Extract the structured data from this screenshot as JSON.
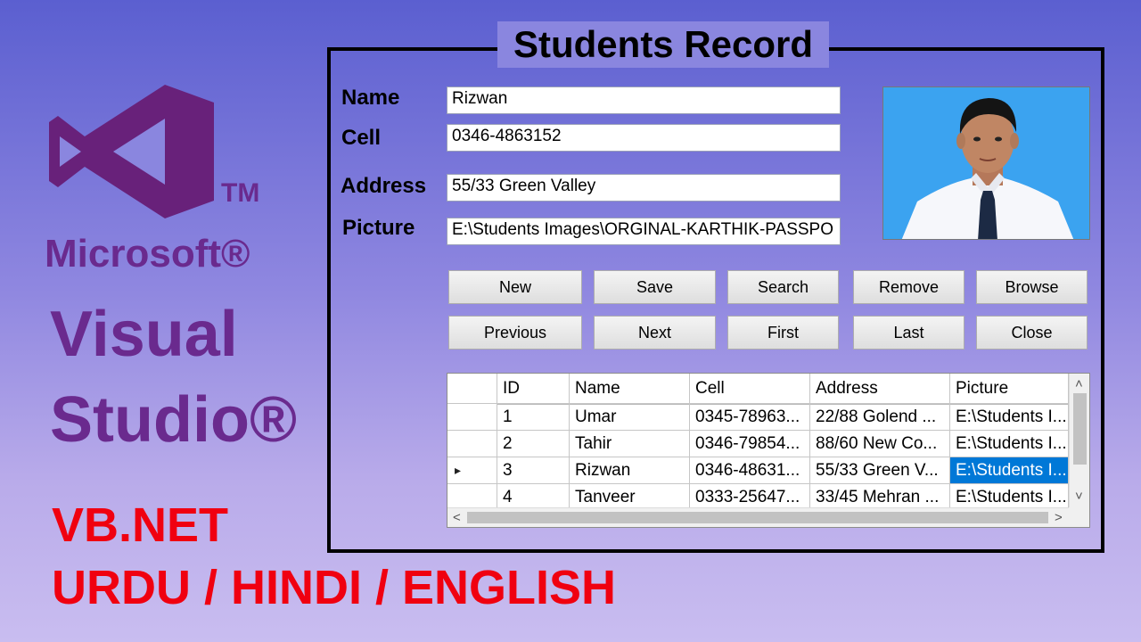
{
  "branding": {
    "tm": "TM",
    "microsoft": "Microsoft®",
    "visual": "Visual",
    "studio": "Studio®",
    "vbnet": "VB.NET",
    "languages": "URDU / HINDI / ENGLISH",
    "logo_color": "#68217a",
    "text_color": "#6a2a8e",
    "accent_red": "#f00010"
  },
  "form": {
    "title": "Students Record",
    "fields": {
      "name": {
        "label": "Name",
        "value": "Rizwan"
      },
      "cell": {
        "label": "Cell",
        "value": "0346-4863152"
      },
      "address": {
        "label": "Address",
        "value": "55/33 Green Valley"
      },
      "picture": {
        "label": "Picture",
        "value": "E:\\Students Images\\ORGINAL-KARTHIK-PASSPO"
      }
    },
    "buttons": {
      "new": "New",
      "save": "Save",
      "search": "Search",
      "remove": "Remove",
      "browse": "Browse",
      "previous": "Previous",
      "next": "Next",
      "first": "First",
      "last": "Last",
      "close": "Close"
    }
  },
  "grid": {
    "columns": [
      "ID",
      "Name",
      "Cell",
      "Address",
      "Picture"
    ],
    "rows": [
      [
        "1",
        "Umar",
        "0345-78963...",
        "22/88 Golend ...",
        "E:\\Students I..."
      ],
      [
        "2",
        "Tahir",
        "0346-79854...",
        "88/60 New Co...",
        "E:\\Students I..."
      ],
      [
        "3",
        "Rizwan",
        "0346-48631...",
        "55/33 Green V...",
        "E:\\Students I..."
      ],
      [
        "4",
        "Tanveer",
        "0333-25647...",
        "33/45 Mehran ...",
        "E:\\Students I..."
      ]
    ],
    "current_row_indicator": "▸",
    "selection_color": "#0078d7",
    "scroll_up": "˄",
    "scroll_down": "˅",
    "scroll_left": "<",
    "scroll_right": ">"
  }
}
